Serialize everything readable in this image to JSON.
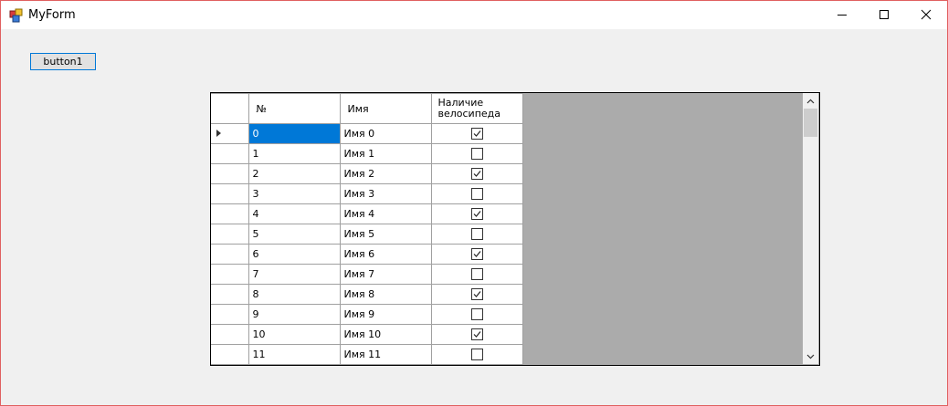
{
  "window": {
    "title": "MyForm"
  },
  "form": {
    "button1_label": "button1"
  },
  "grid": {
    "columns": [
      "№",
      "Имя",
      "Наличие велосипеда"
    ],
    "selected_row": 0,
    "rows": [
      {
        "num": "0",
        "name": "Имя 0",
        "bike": true
      },
      {
        "num": "1",
        "name": "Имя 1",
        "bike": false
      },
      {
        "num": "2",
        "name": "Имя 2",
        "bike": true
      },
      {
        "num": "3",
        "name": "Имя 3",
        "bike": false
      },
      {
        "num": "4",
        "name": "Имя 4",
        "bike": true
      },
      {
        "num": "5",
        "name": "Имя 5",
        "bike": false
      },
      {
        "num": "6",
        "name": "Имя 6",
        "bike": true
      },
      {
        "num": "7",
        "name": "Имя 7",
        "bike": false
      },
      {
        "num": "8",
        "name": "Имя 8",
        "bike": true
      },
      {
        "num": "9",
        "name": "Имя 9",
        "bike": false
      },
      {
        "num": "10",
        "name": "Имя 10",
        "bike": true
      },
      {
        "num": "11",
        "name": "Имя 11",
        "bike": false
      }
    ]
  },
  "colors": {
    "selection": "#0078d7",
    "grid_background": "#ababab",
    "window_border": "#e06060"
  }
}
